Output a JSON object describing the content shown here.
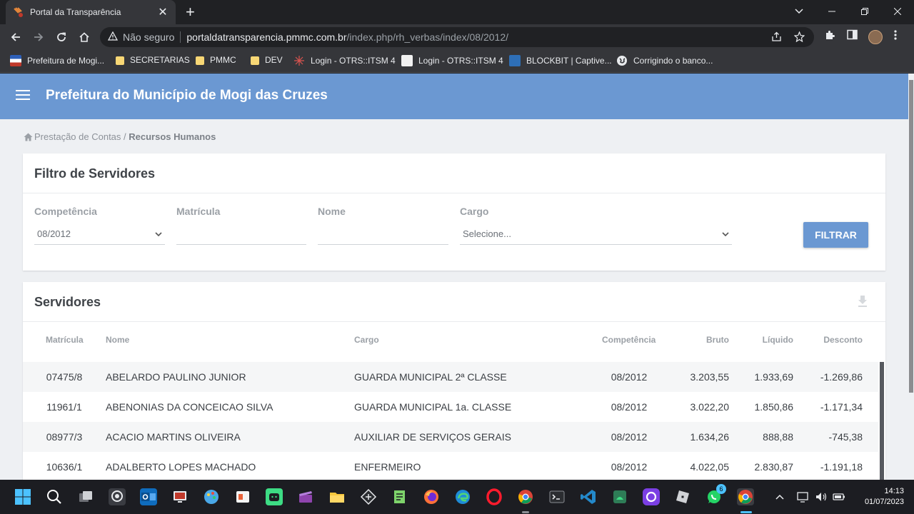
{
  "browser": {
    "tab_title": "Portal da Transparência",
    "close_glyph": "✕",
    "new_tab_glyph": "+",
    "security_label": "Não seguro",
    "url_host": "portaldatransparencia.pmmc.com.br",
    "url_path": "/index.php/rh_verbas/index/08/2012/",
    "bookmarks": [
      "Prefeitura de Mogi...",
      "SECRETARIAS",
      "PMMC",
      "DEV",
      "Login - OTRS::ITSM 4",
      "Login - OTRS::ITSM 4",
      "BLOCKBIT | Captive...",
      "Corrigindo o banco..."
    ]
  },
  "app": {
    "title": "Prefeitura do Município de Mogi das Cruzes",
    "accent": "#6b98d2"
  },
  "breadcrumb": {
    "parent": "Prestação de Contas",
    "separator": " / ",
    "current": "Recursos Humanos"
  },
  "filter": {
    "heading": "Filtro de Servidores",
    "competencia_label": "Competência",
    "competencia_value": "08/2012",
    "matricula_label": "Matrícula",
    "matricula_value": "",
    "nome_label": "Nome",
    "nome_value": "",
    "cargo_label": "Cargo",
    "cargo_value": "Selecione...",
    "button_label": "FILTRAR"
  },
  "servidores": {
    "heading": "Servidores",
    "columns": [
      "Matrícula",
      "Nome",
      "Cargo",
      "Competência",
      "Bruto",
      "Líquido",
      "Desconto"
    ],
    "rows": [
      [
        "07475/8",
        "ABELARDO PAULINO JUNIOR",
        "GUARDA MUNICIPAL 2ª CLASSE",
        "08/2012",
        "3.203,55",
        "1.933,69",
        "-1.269,86"
      ],
      [
        "11961/1",
        "ABENONIAS DA CONCEICAO SILVA",
        "GUARDA MUNICIPAL 1a. CLASSE",
        "08/2012",
        "3.022,20",
        "1.850,86",
        "-1.171,34"
      ],
      [
        "08977/3",
        "ACACIO MARTINS OLIVEIRA",
        "AUXILIAR DE SERVIÇOS GERAIS",
        "08/2012",
        "1.634,26",
        "888,88",
        "-745,38"
      ],
      [
        "10636/1",
        "ADALBERTO LOPES MACHADO",
        "ENFERMEIRO",
        "08/2012",
        "4.022,05",
        "2.830,87",
        "-1.191,18"
      ]
    ]
  },
  "taskbar": {
    "whatsapp_badge": "6",
    "time": "14:13",
    "date": "01/07/2023"
  }
}
